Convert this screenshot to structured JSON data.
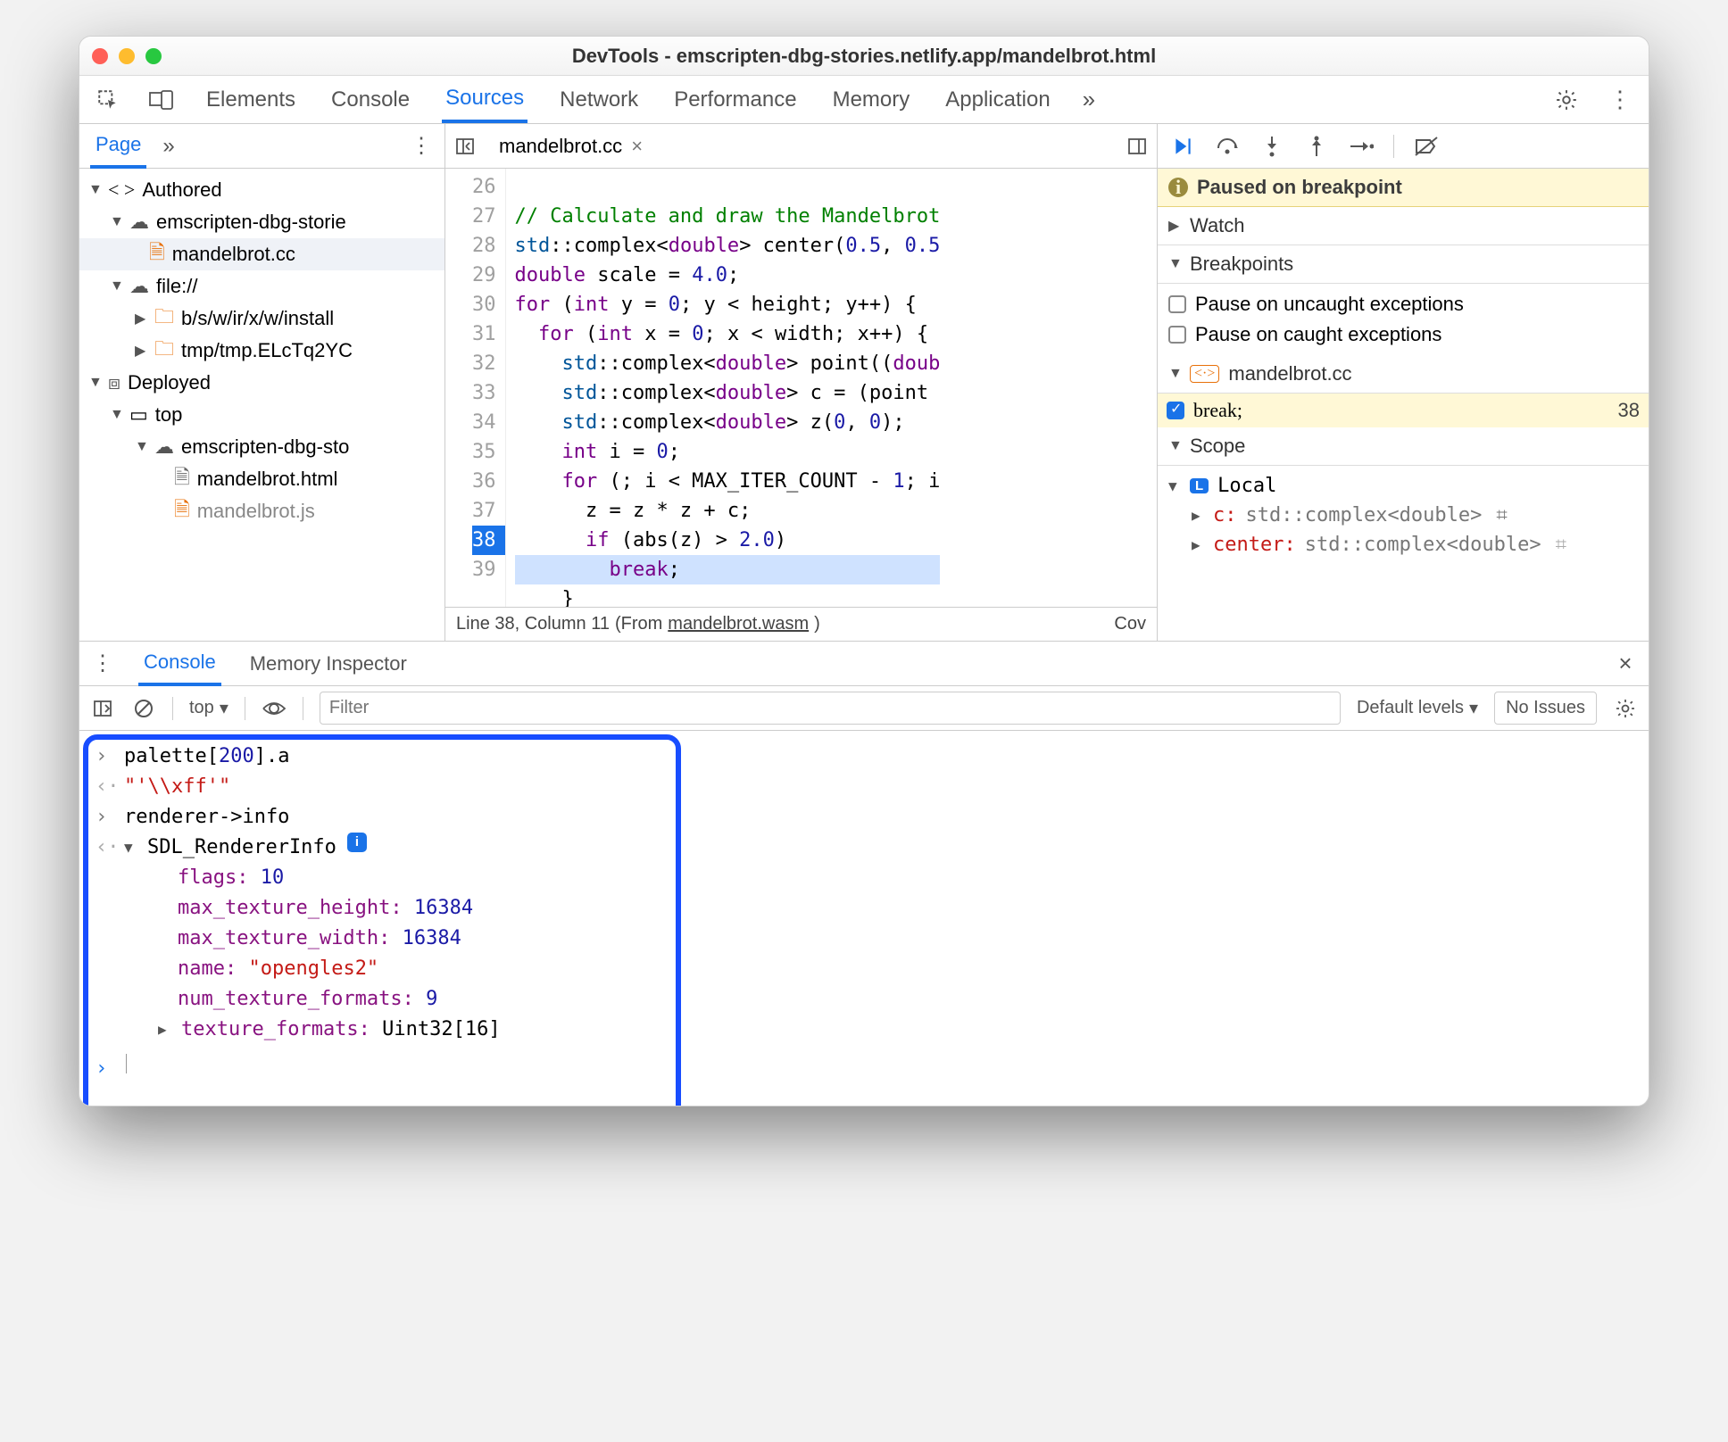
{
  "window": {
    "title": "DevTools - emscripten-dbg-stories.netlify.app/mandelbrot.html"
  },
  "tabs": {
    "items": [
      "Elements",
      "Console",
      "Sources",
      "Network",
      "Performance",
      "Memory",
      "Application"
    ],
    "active_index": 2
  },
  "left": {
    "tab": "Page",
    "more_label": "»",
    "tree": {
      "authored": "Authored",
      "origin1": "emscripten-dbg-storie",
      "file_cc": "mandelbrot.cc",
      "file_scheme": "file://",
      "folder1": "b/s/w/ir/x/w/install",
      "folder2": "tmp/tmp.ELcTq2YC",
      "deployed": "Deployed",
      "top": "top",
      "origin2": "emscripten-dbg-sto",
      "file_html": "mandelbrot.html",
      "file_js": "mandelbrot.js"
    }
  },
  "editor": {
    "tab_label": "mandelbrot.cc",
    "lines": {
      "start": 26,
      "end": 39,
      "current": 38
    },
    "code": {
      "l26": "// Calculate and draw the Mandelbrot",
      "l27_a": "std",
      "l27_b": "::complex<",
      "l27_c": "double",
      "l27_d": "> center(",
      "l27_e": "0.5",
      "l27_f": ", ",
      "l27_g": "0.5",
      "l28_a": "double",
      "l28_b": " scale = ",
      "l28_c": "4.0",
      "l28_d": ";",
      "l29_a": "for",
      "l29_b": " (",
      "l29_c": "int",
      "l29_d": " y = ",
      "l29_e": "0",
      "l29_f": "; y < height; y++) {",
      "l30_a": "  for",
      "l30_b": " (",
      "l30_c": "int",
      "l30_d": " x = ",
      "l30_e": "0",
      "l30_f": "; x < width; x++) {",
      "l31_a": "    std",
      "l31_b": "::complex<",
      "l31_c": "double",
      "l31_d": "> point((",
      "l31_e": "doub",
      "l32_a": "    std",
      "l32_b": "::complex<",
      "l32_c": "double",
      "l32_d": "> c = (point ",
      "l33_a": "    std",
      "l33_b": "::complex<",
      "l33_c": "double",
      "l33_d": "> z(",
      "l33_e": "0",
      "l33_f": ", ",
      "l33_g": "0",
      "l33_h": ");",
      "l34_a": "    int",
      "l34_b": " i = ",
      "l34_c": "0",
      "l34_d": ";",
      "l35_a": "    for",
      "l35_b": " (; i < MAX_ITER_COUNT - ",
      "l35_c": "1",
      "l35_d": "; i",
      "l36": "      z = z * z + c;",
      "l37_a": "      if",
      "l37_b": " (abs(z) > ",
      "l37_c": "2.0",
      "l37_d": ")",
      "l38_a": "        ",
      "l38_b": "break",
      "l38_c": ";",
      "l39": "    }"
    },
    "status": {
      "pos": "Line 38, Column 11",
      "from_prefix": "(From ",
      "from_link": "mandelbrot.wasm",
      "from_suffix": ")",
      "coverage": "Cov"
    }
  },
  "right": {
    "paused": "Paused on breakpoint",
    "sections": {
      "watch": "Watch",
      "breakpoints": "Breakpoints",
      "pause_uncaught": "Pause on uncaught exceptions",
      "pause_caught": "Pause on caught exceptions",
      "bp_file": "mandelbrot.cc",
      "bp_code": "break;",
      "bp_line": "38",
      "scope": "Scope",
      "local": "Local",
      "var_c_name": "c:",
      "var_c_type": "std::complex<double>",
      "var_center_name": "center:",
      "var_center_type": "std::complex<double>"
    }
  },
  "drawer": {
    "tabs": {
      "console": "Console",
      "memory": "Memory Inspector"
    },
    "toolbar": {
      "context": "top",
      "filter_placeholder": "Filter",
      "levels": "Default levels",
      "issues": "No Issues"
    },
    "console": {
      "evals": {
        "e1_in_a": "palette[",
        "e1_in_b": "200",
        "e1_in_c": "].a",
        "e1_out": "\"'\\\\xff'\"",
        "e2_in": "renderer->info",
        "obj_name": "SDL_RendererInfo",
        "p_flags_k": "flags:",
        "p_flags_v": "10",
        "p_mth_k": "max_texture_height:",
        "p_mth_v": "16384",
        "p_mtw_k": "max_texture_width:",
        "p_mtw_v": "16384",
        "p_name_k": "name:",
        "p_name_v": "\"opengles2\"",
        "p_ntf_k": "num_texture_formats:",
        "p_ntf_v": "9",
        "p_tf_k": "texture_formats:",
        "p_tf_v": "Uint32[16]"
      }
    }
  }
}
